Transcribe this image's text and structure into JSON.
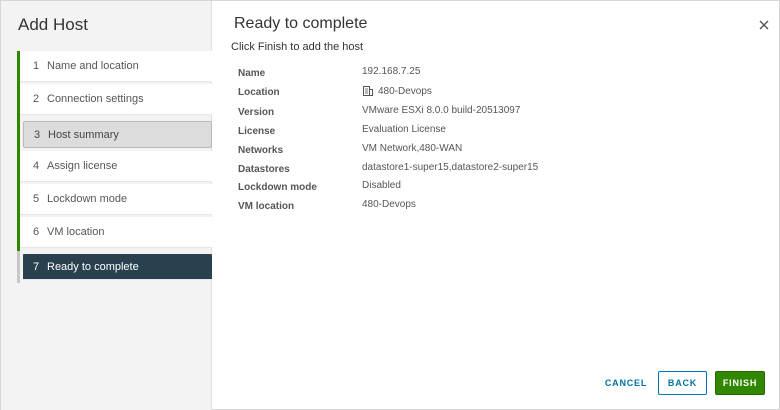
{
  "wizard": {
    "title": "Add Host",
    "steps": [
      {
        "num": "1",
        "label": "Name and location"
      },
      {
        "num": "2",
        "label": "Connection settings"
      },
      {
        "num": "3",
        "label": "Host summary"
      },
      {
        "num": "4",
        "label": "Assign license"
      },
      {
        "num": "5",
        "label": "Lockdown mode"
      },
      {
        "num": "6",
        "label": "VM location"
      },
      {
        "num": "7",
        "label": "Ready to complete"
      }
    ]
  },
  "main": {
    "title": "Ready to complete",
    "subtitle": "Click Finish to add the host",
    "details": [
      {
        "key": "Name",
        "value": "192.168.7.25"
      },
      {
        "key": "Location",
        "value": "480-Devops",
        "icon": "datacenter-icon"
      },
      {
        "key": "Version",
        "value": "VMware ESXi 8.0.0 build-20513097"
      },
      {
        "key": "License",
        "value": "Evaluation License"
      },
      {
        "key": "Networks",
        "value": "VM Network,480-WAN"
      },
      {
        "key": "Datastores",
        "value": "datastore1-super15,datastore2-super15"
      },
      {
        "key": "Lockdown mode",
        "value": "Disabled"
      },
      {
        "key": "VM location",
        "value": "480-Devops"
      }
    ]
  },
  "footer": {
    "cancel_label": "CANCEL",
    "back_label": "BACK",
    "finish_label": "FINISH"
  },
  "colors": {
    "accent_green": "#318700",
    "current_step_bg": "#29414e",
    "link_blue": "#0072a3"
  }
}
